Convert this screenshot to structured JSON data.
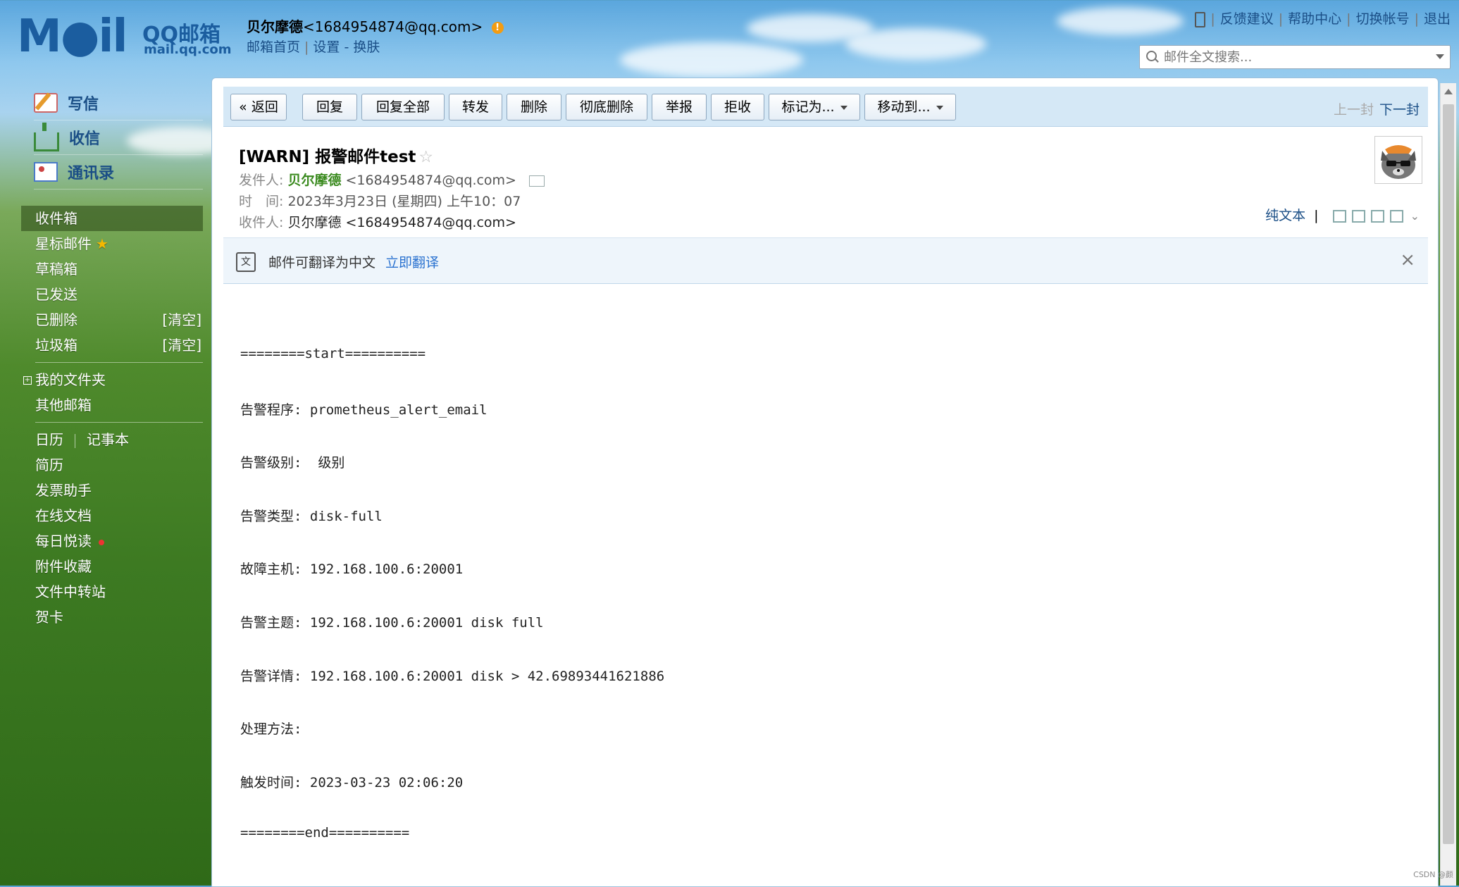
{
  "header": {
    "logo_mail": "M●il",
    "logo_qq": "QQ邮箱",
    "logo_domain": "mail.qq.com",
    "user_name": "贝尔摩德",
    "user_email": "<1684954874@qq.com>",
    "warn_mark": "!",
    "links": {
      "home": "邮箱首页",
      "settings": "设置",
      "dash": "-",
      "skin": "换肤"
    },
    "top_links": {
      "feedback": "反馈建议",
      "help": "帮助中心",
      "switch": "切换帐号",
      "logout": "退出"
    },
    "search_placeholder": "邮件全文搜索..."
  },
  "sidebar": {
    "main": {
      "write": "写信",
      "receive": "收信",
      "contacts": "通讯录"
    },
    "folders": {
      "inbox": "收件箱",
      "starred": "星标邮件",
      "drafts": "草稿箱",
      "sent": "已发送",
      "deleted": "已删除",
      "spam": "垃圾箱",
      "clear": "[清空]",
      "my_folders": "我的文件夹",
      "other_mailboxes": "其他邮箱"
    },
    "apps": {
      "calendar": "日历",
      "notes": "记事本",
      "resume": "简历",
      "invoice": "发票助手",
      "docs": "在线文档",
      "daily_reading": "每日悦读",
      "attachments": "附件收藏",
      "file_transfer": "文件中转站",
      "cards": "贺卡"
    }
  },
  "toolbar": {
    "back": "« 返回",
    "reply": "回复",
    "reply_all": "回复全部",
    "forward": "转发",
    "delete": "删除",
    "delete_permanent": "彻底删除",
    "report": "举报",
    "reject": "拒收",
    "mark_as": "标记为...",
    "move_to": "移动到...",
    "prev": "上一封",
    "next": "下一封"
  },
  "email": {
    "subject": "[WARN] 报警邮件test",
    "sender_label": "发件人:",
    "sender_name": "贝尔摩德",
    "sender_email": "<1684954874@qq.com>",
    "time_label": "时　间:",
    "time_value": "2023年3月23日 (星期四) 上午10：07",
    "recipient_label": "收件人:",
    "recipient_value": "贝尔摩德 <1684954874@qq.com>",
    "plain_text": "纯文本",
    "bar": "|",
    "translate_notice": "邮件可翻译为中文",
    "translate_now": "立即翻译",
    "translate_icon": "文",
    "close": "×",
    "body_lines": [
      "========start==========",
      "告警程序: prometheus_alert_email",
      "告警级别:  级别",
      "告警类型: disk-full",
      "故障主机: 192.168.100.6:20001",
      "告警主题: 192.168.100.6:20001 disk full",
      "告警详情: 192.168.100.6:20001 disk > 42.69893441621886",
      "处理方法:",
      "触发时间: 2023-03-23 02:06:20",
      "========end=========="
    ]
  },
  "watermark": "CSDN @颜"
}
